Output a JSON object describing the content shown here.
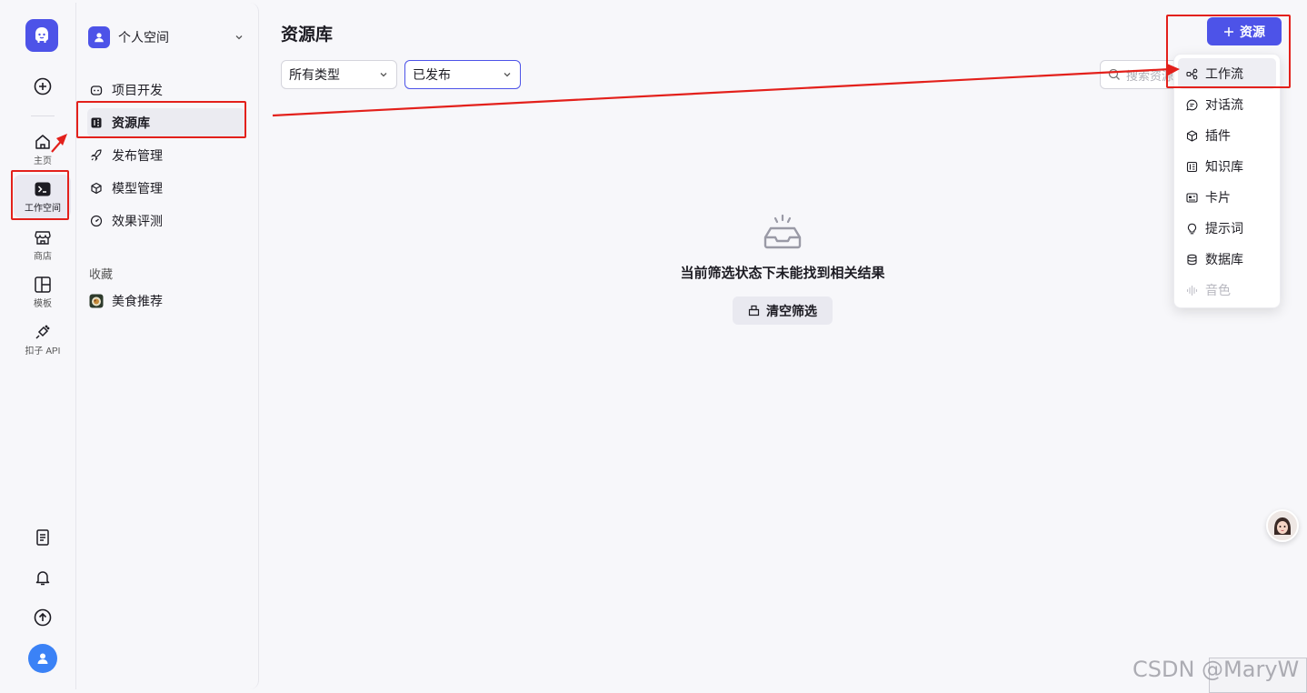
{
  "rail": {
    "items": [
      {
        "label": "主页"
      },
      {
        "label": "工作空间"
      },
      {
        "label": "商店"
      },
      {
        "label": "模板"
      },
      {
        "label": "扣子 API"
      }
    ]
  },
  "sidebar": {
    "space_name": "个人空间",
    "nav": [
      {
        "label": "项目开发"
      },
      {
        "label": "资源库"
      },
      {
        "label": "发布管理"
      },
      {
        "label": "模型管理"
      },
      {
        "label": "效果评测"
      }
    ],
    "favorites_title": "收藏",
    "favorites": [
      {
        "label": "美食推荐"
      }
    ]
  },
  "main": {
    "title": "资源库",
    "filter_type": "所有类型",
    "filter_status": "已发布",
    "search_placeholder": "搜索资源",
    "add_button": "资源",
    "empty_text": "当前筛选状态下未能找到相关结果",
    "clear_button": "清空筛选"
  },
  "dropdown": {
    "items": [
      {
        "label": "工作流",
        "icon": "workflow-icon"
      },
      {
        "label": "对话流",
        "icon": "chatflow-icon"
      },
      {
        "label": "插件",
        "icon": "plugin-icon"
      },
      {
        "label": "知识库",
        "icon": "knowledge-icon"
      },
      {
        "label": "卡片",
        "icon": "card-icon"
      },
      {
        "label": "提示词",
        "icon": "prompt-icon"
      },
      {
        "label": "数据库",
        "icon": "database-icon"
      },
      {
        "label": "音色",
        "icon": "voice-icon"
      }
    ]
  },
  "watermark": "CSDN @MaryW",
  "colors": {
    "accent": "#4d53e8",
    "annotation": "#e3201b"
  }
}
